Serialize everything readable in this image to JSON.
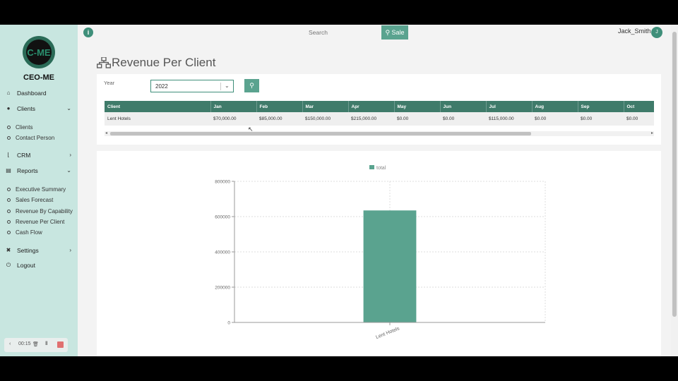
{
  "brand": {
    "logo_text": "CEO-ME",
    "logo_mark": "C-ME"
  },
  "sidebar": {
    "items": [
      {
        "label": "Dashboard",
        "icon": "home-icon",
        "chevron": ""
      },
      {
        "label": "Clients",
        "icon": "users-icon",
        "chevron": "⌄"
      },
      {
        "label": "CRM",
        "icon": "chart-line-icon",
        "chevron": "›"
      },
      {
        "label": "Reports",
        "icon": "file-icon",
        "chevron": "⌄"
      },
      {
        "label": "Settings",
        "icon": "wrench-icon",
        "chevron": "›"
      },
      {
        "label": "Logout",
        "icon": "power-icon",
        "chevron": ""
      }
    ],
    "clients_sub": [
      "Clients",
      "Contact Person"
    ],
    "reports_sub": [
      "Executive Summary",
      "Sales Forecast",
      "Revenue By Capability",
      "Revenue Per Client",
      "Cash Flow"
    ]
  },
  "recorder": {
    "time": "00:15"
  },
  "topbar": {
    "info": "i",
    "search_placeholder": "Search",
    "sale_label": "Sale",
    "user_name": "Jack_Smith",
    "avatar_initial": "J"
  },
  "page": {
    "title": "Revenue Per Client"
  },
  "filter": {
    "year_label": "Year",
    "year_value": "2022"
  },
  "table": {
    "columns": [
      "Client",
      "Jan",
      "Feb",
      "Mar",
      "Apr",
      "May",
      "Jun",
      "Jul",
      "Aug",
      "Sep",
      "Oct"
    ],
    "rows": [
      [
        "Lent Hotels",
        "$70,000.00",
        "$85,000.00",
        "$150,000.00",
        "$215,000.00",
        "$0.00",
        "$0.00",
        "$115,000.00",
        "$0.00",
        "$0.00",
        "$0.00"
      ]
    ]
  },
  "colors": {
    "accent": "#5aa38f",
    "dark_accent": "#3f7b6a",
    "sidebar": "#c8e6e0",
    "bar": "#5aa38f"
  },
  "chart_data": {
    "type": "bar",
    "categories": [
      "Lent Hotels"
    ],
    "series": [
      {
        "name": "total",
        "values": [
          635000
        ]
      }
    ],
    "title": "",
    "xlabel": "",
    "ylabel": "",
    "ylim": [
      0,
      800000
    ],
    "yticks": [
      "0",
      "200000",
      "400000",
      "600000",
      "800000"
    ],
    "grid": true,
    "legend": "top-center"
  }
}
